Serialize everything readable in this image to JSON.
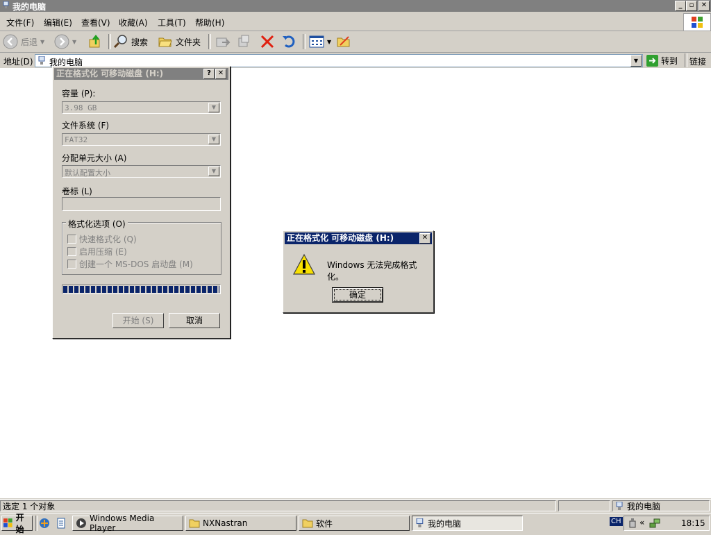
{
  "window": {
    "title": "我的电脑",
    "min_label": "_",
    "max_label": "▫",
    "close_label": "✕"
  },
  "menu": {
    "items": [
      {
        "label": "文件(F)"
      },
      {
        "label": "编辑(E)"
      },
      {
        "label": "查看(V)"
      },
      {
        "label": "收藏(A)"
      },
      {
        "label": "工具(T)"
      },
      {
        "label": "帮助(H)"
      }
    ]
  },
  "toolbar": {
    "back_label": "后退",
    "search_label": "搜索",
    "folders_label": "文件夹"
  },
  "address": {
    "label": "地址(D)",
    "value": "我的电脑",
    "go_label": "转到",
    "links_label": "链接"
  },
  "format_dialog": {
    "title": "正在格式化 可移动磁盘 (H:)",
    "help_label": "?",
    "close_label": "✕",
    "capacity_label": "容量 (P):",
    "capacity_value": "3.98 GB",
    "filesystem_label": "文件系统 (F)",
    "filesystem_value": "FAT32",
    "allocation_label": "分配单元大小 (A)",
    "allocation_value": "默认配置大小",
    "volume_label": "卷标 (L)",
    "volume_value": "",
    "options_label": "格式化选项 (O)",
    "options": [
      {
        "label": "快速格式化 (Q)"
      },
      {
        "label": "启用压缩 (E)"
      },
      {
        "label": "创建一个 MS-DOS 启动盘 (M)"
      }
    ],
    "progress": 1.0,
    "start_label": "开始 (S)",
    "cancel_label": "取消"
  },
  "error_dialog": {
    "title": "正在格式化 可移动磁盘 (H:)",
    "close_label": "✕",
    "message": "Windows 无法完成格式化。",
    "ok_label": "确定"
  },
  "statusbar": {
    "left_text": "选定 1 个对象",
    "right_text": "我的电脑"
  },
  "taskbar": {
    "start_label": "开始",
    "tasks": [
      {
        "label": "Windows Media Player"
      },
      {
        "label": "NXNastran"
      },
      {
        "label": "软件"
      },
      {
        "label": "我的电脑"
      }
    ],
    "lang": "CH",
    "chevron": "«",
    "clock": "18:15"
  },
  "colors": {
    "face": "#d4d0c8",
    "active_title": "#0a246a",
    "inactive_title": "#808080",
    "progress": "#0a246a"
  }
}
